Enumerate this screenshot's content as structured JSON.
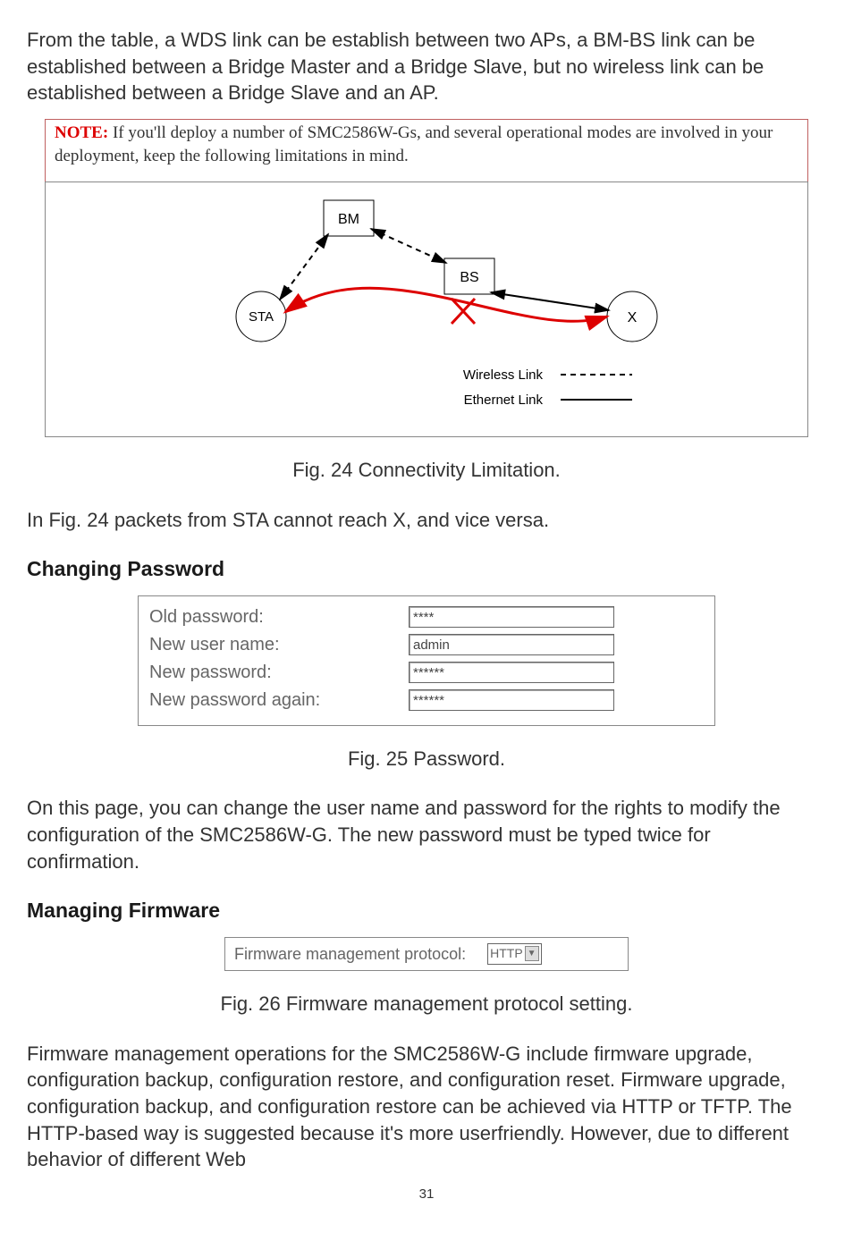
{
  "intro": "From the table, a WDS link can be establish between two APs, a BM-BS link can be established between a Bridge Master and a Bridge Slave, but no wireless link can be established between a Bridge Slave and an AP.",
  "note": {
    "label": "NOTE:",
    "text": "If you'll deploy a number of SMC2586W-Gs, and several operational modes are involved in your deployment, keep the following limitations in mind."
  },
  "diagram": {
    "node_bm": "BM",
    "node_bs": "BS",
    "node_sta": "STA",
    "node_x": "X",
    "legend_wireless": "Wireless Link",
    "legend_ethernet": "Ethernet Link"
  },
  "fig24_caption": "Fig. 24 Connectivity Limitation.",
  "after_fig24": "In Fig. 24 packets from STA cannot reach X, and vice versa.",
  "heading_password": "Changing Password",
  "password_form": {
    "old_password_label": "Old password:",
    "old_password_value": "****",
    "new_user_label": "New user name:",
    "new_user_value": "admin",
    "new_password_label": "New password:",
    "new_password_value": "******",
    "new_password_again_label": "New password again:",
    "new_password_again_value": "******"
  },
  "fig25_caption": "Fig. 25 Password.",
  "password_para": "On this page, you can change the user name and password for the rights to modify the configuration of the SMC2586W-G. The new password must be typed twice for confirmation.",
  "heading_firmware": "Managing Firmware",
  "firmware_form": {
    "label": "Firmware management protocol:",
    "value": "HTTP"
  },
  "fig26_caption": "Fig. 26 Firmware management protocol setting.",
  "firmware_para": "Firmware management operations for the SMC2586W-G include firmware upgrade, configuration backup, configuration restore, and configuration reset. Firmware upgrade, configuration backup, and configuration restore can be achieved via HTTP or TFTP. The HTTP-based way is suggested because it's more userfriendly. However, due to different behavior of different Web",
  "page_number": "31"
}
